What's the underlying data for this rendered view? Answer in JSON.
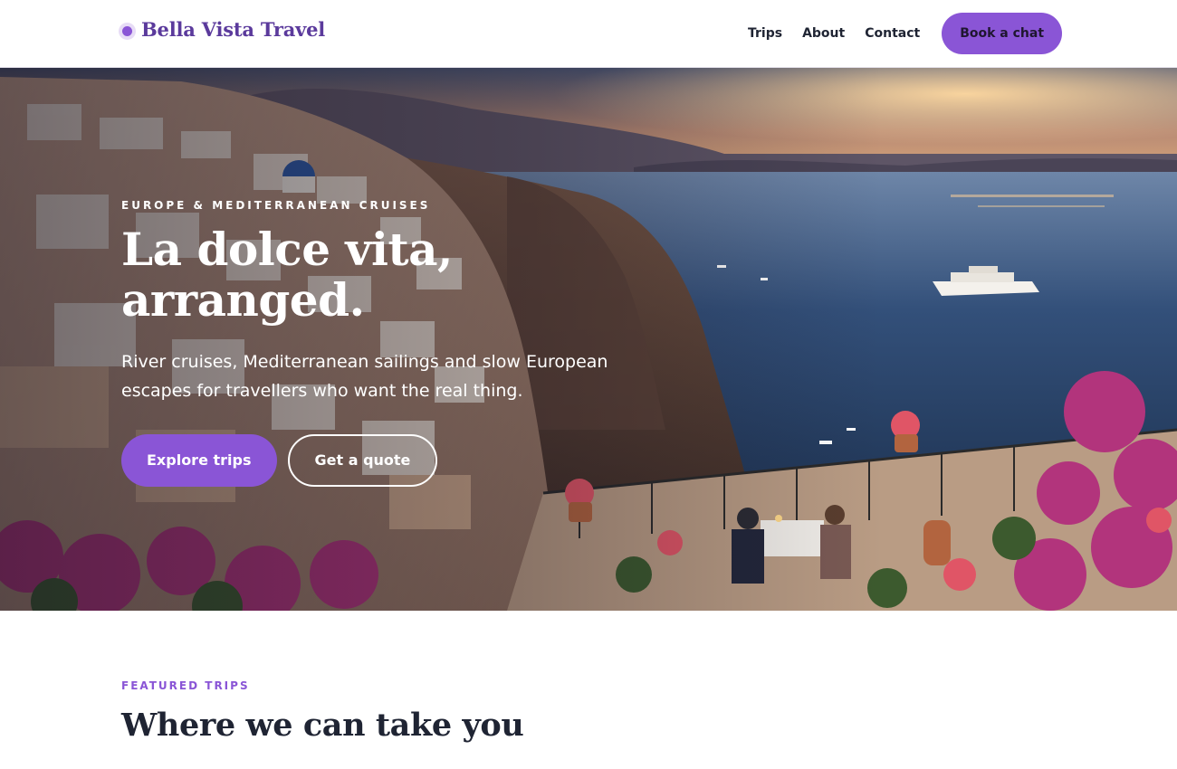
{
  "header": {
    "brand_name": "Bella Vista Travel",
    "brand_icon": "dot-logo-icon",
    "nav": [
      {
        "label": "Trips"
      },
      {
        "label": "About"
      },
      {
        "label": "Contact"
      }
    ],
    "cta_label": "Book a chat"
  },
  "hero": {
    "eyebrow": "EUROPE & MEDITERRANEAN CRUISES",
    "title": "La dolce vita,\narranged.",
    "subtitle": "River cruises, Mediterranean sailings and slow European escapes for travellers who want the real thing.",
    "primary_button": "Explore trips",
    "secondary_button": "Get a quote"
  },
  "featured": {
    "eyebrow": "FEATURED TRIPS",
    "title": "Where we can take you"
  },
  "colors": {
    "accent": "#8a55d6",
    "brand_text": "#5b3a9c",
    "heading": "#1f2433"
  }
}
